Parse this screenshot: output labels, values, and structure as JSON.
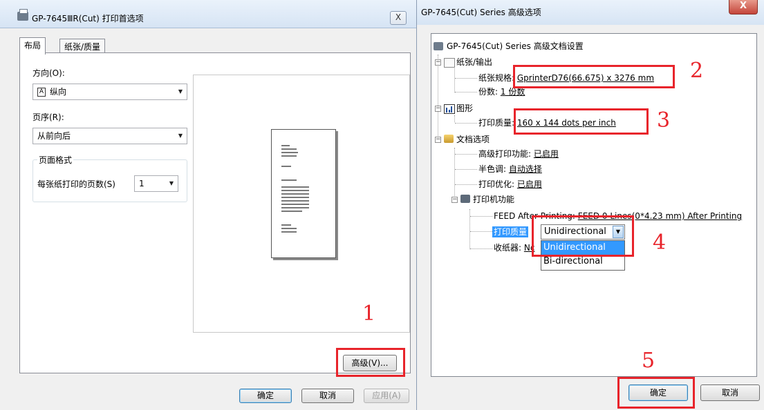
{
  "left_dialog": {
    "title": "GP-7645ⅢR(Cut) 打印首选项",
    "close_label": "X",
    "tabs": [
      {
        "label": "布局"
      },
      {
        "label": "纸张/质量"
      }
    ],
    "orientation": {
      "label": "方向(O):",
      "value": "纵向",
      "icon_glyph": "A"
    },
    "page_order": {
      "label": "页序(R):",
      "value": "从前向后"
    },
    "page_format": {
      "legend": "页面格式",
      "pages_per_sheet_label": "每张纸打印的页数(S)",
      "pages_per_sheet_value": "1"
    },
    "advanced_button": "高级(V)...",
    "ok_button": "确定",
    "cancel_button": "取消",
    "apply_button": "应用(A)"
  },
  "right_dialog": {
    "title": "GP-7645(Cut) Series 高级选项",
    "close_label": "X",
    "tree": {
      "root": "GP-7645(Cut) Series 高级文档设置",
      "paper_output": {
        "label": "纸张/输出",
        "paper_size_label": "纸张规格:",
        "paper_size_value": "GprinterD76(66.675) x 3276 mm",
        "copies_label": "份数:",
        "copies_value": "1 份数"
      },
      "graphic": {
        "label": "图形",
        "print_quality_label": "打印质量:",
        "print_quality_value": "160 x 144 dots per inch"
      },
      "document_options": {
        "label": "文档选项",
        "advanced_printing_label": "高级打印功能:",
        "advanced_printing_value": "已启用",
        "halftone_label": "半色调:",
        "halftone_value": "自动选择",
        "print_optimization_label": "打印优化:",
        "print_optimization_value": "已启用",
        "printer_features": {
          "label": "打印机功能",
          "feed_label": "FEED After Printing:",
          "feed_value": "FEED 0 Lines(0*4.23 mm) After Printing",
          "print_quality_label": "打印质量",
          "print_quality_selected": "Unidirectional",
          "print_quality_options": [
            "Unidirectional",
            "Bi-directional"
          ],
          "receiver_label": "收纸器:",
          "receiver_value_partial": "Nc"
        }
      }
    },
    "ok_button": "确定",
    "cancel_button": "取消"
  },
  "annotations": {
    "step_numbers": [
      "1",
      "2",
      "3",
      "4",
      "5"
    ],
    "color": "#e8242b"
  },
  "colors": {
    "highlight": "#3399ff",
    "titlebar": "#d6e4f4",
    "dialog_bg": "#f0f0f0"
  }
}
